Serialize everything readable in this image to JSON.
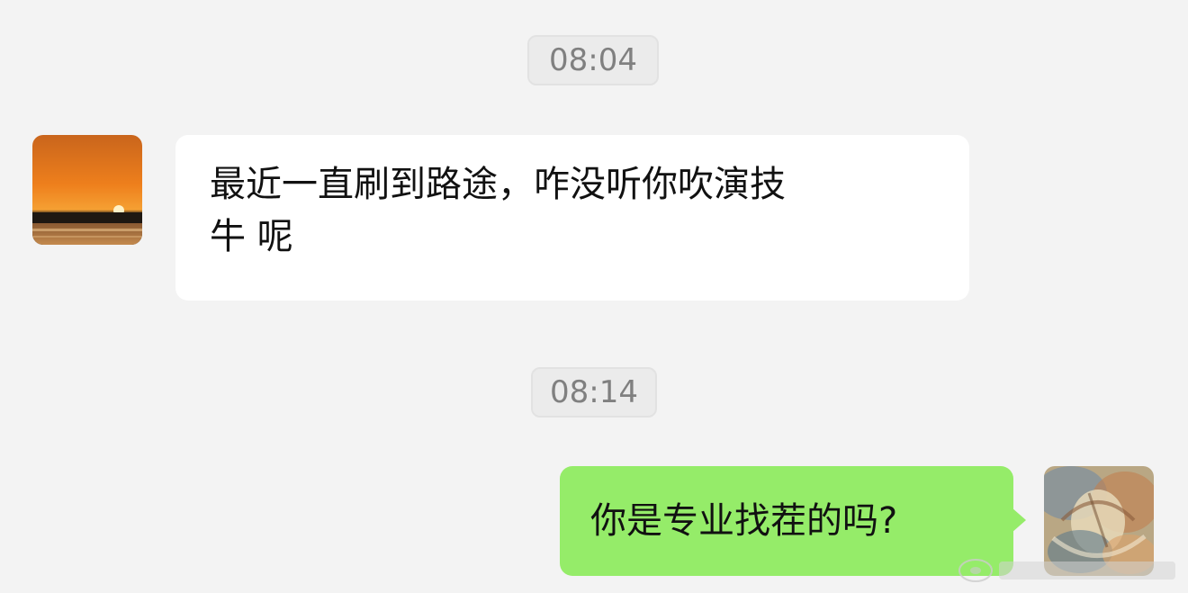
{
  "chat": {
    "timestamps": [
      "08:04",
      "08:14"
    ],
    "messages": [
      {
        "sender": "other",
        "lines": [
          "最近一直刷到路途，咋没听你吹演技",
          "牛    呢"
        ],
        "avatar_icon": "sunset-avatar"
      },
      {
        "sender": "self",
        "text": "你是专业找茬的吗?",
        "avatar_icon": "painting-avatar"
      }
    ]
  },
  "colors": {
    "background": "#f3f3f3",
    "incoming_bubble": "#ffffff",
    "outgoing_bubble": "#95ec69",
    "timestamp_bg": "#ebebeb",
    "timestamp_text": "#808080",
    "message_text": "#111111"
  }
}
